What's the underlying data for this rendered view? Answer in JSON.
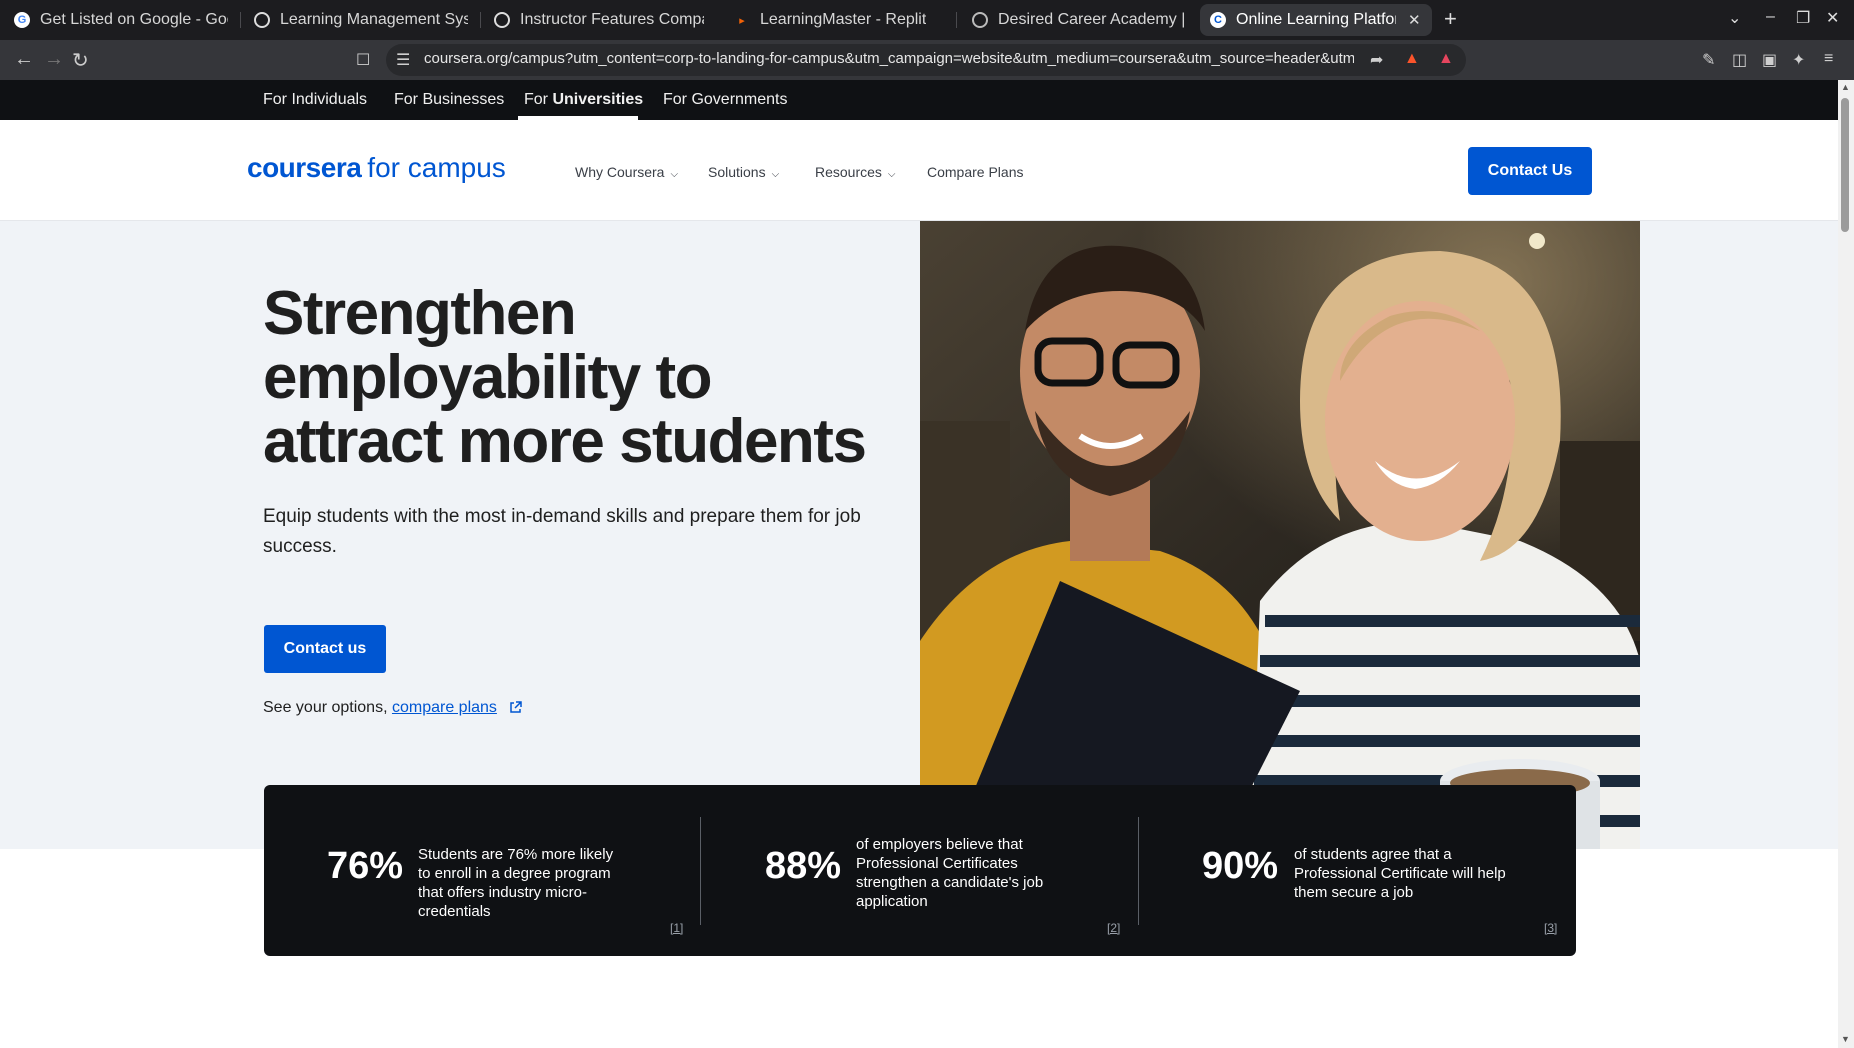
{
  "browser": {
    "tabs": [
      {
        "title": "Get Listed on Google - Goog",
        "icon": "google-icon"
      },
      {
        "title": "Learning Management Syste",
        "icon": "openai-icon"
      },
      {
        "title": "Instructor Features Compari",
        "icon": "openai-icon"
      },
      {
        "title": "LearningMaster - Replit",
        "icon": "replit-icon"
      },
      {
        "title": "Desired Career Academy | Er",
        "icon": "globe-icon"
      },
      {
        "title": "Online Learning Platform",
        "icon": "coursera-icon",
        "active": true
      }
    ],
    "url": "coursera.org/campus?utm_content=corp-to-landing-for-campus&utm_campaign=website&utm_medium=coursera&utm_source=header&utm_term..."
  },
  "audience_nav": {
    "items": [
      "For Individuals",
      "For Businesses",
      "For",
      "Universities",
      "For Governments"
    ]
  },
  "header": {
    "logo_brand": "coursera",
    "logo_suffix": "for campus",
    "nav": [
      "Why Coursera",
      "Solutions",
      "Resources",
      "Compare Plans"
    ],
    "cta": "Contact Us"
  },
  "hero": {
    "title": "Strengthen employability to attract more students",
    "subtitle": "Equip students with the most in-demand skills and prepare them for job success.",
    "cta": "Contact us",
    "options_prefix": "See your options, ",
    "options_link": "compare plans"
  },
  "stats": [
    {
      "value": "76%",
      "text": "Students are 76% more likely to enroll in a degree program that offers industry micro-credentials",
      "ref": "[1]"
    },
    {
      "value": "88%",
      "text": "of employers believe that Professional Certificates strengthen a candidate's job application",
      "ref": "[2]"
    },
    {
      "value": "90%",
      "text": "of students agree that a Professional Certificate will help them secure a job",
      "ref": "[3]"
    }
  ],
  "colors": {
    "brand": "#0056d2",
    "dark": "#0f1114",
    "hero_bg": "#f0f3f7"
  }
}
